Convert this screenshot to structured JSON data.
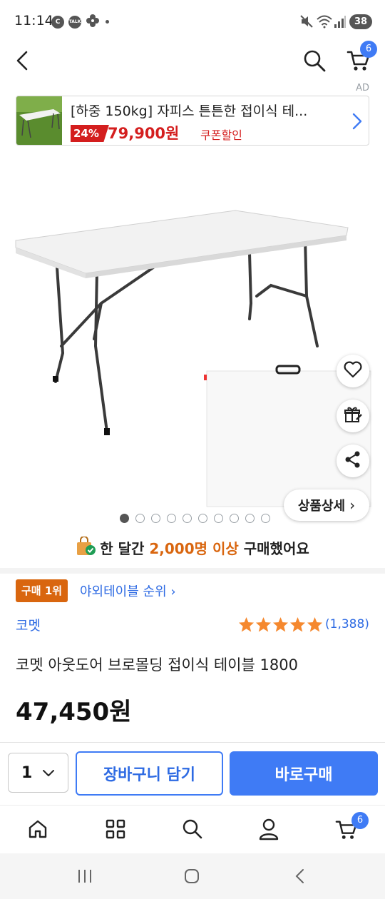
{
  "status_bar": {
    "time": "11:14",
    "notif_icons": [
      "c-icon",
      "talk-icon",
      "pinwheel-icon"
    ],
    "notif_c": "C",
    "notif_talk": "TALK",
    "battery": "38"
  },
  "top_nav": {
    "cart_count": "6"
  },
  "ad": {
    "label": "AD",
    "title": "[하중 150kg] 자피스 튼튼한 접이식 테...",
    "discount": "24%",
    "price": "79,900원",
    "coupon": "쿠폰할인"
  },
  "product": {
    "detail_button": "상품상세",
    "detail_arrow": "›",
    "image_count": 10,
    "active_image": 0,
    "purchase_note": {
      "prefix": "한 달간 ",
      "highlight": "2,000명 이상",
      "suffix": " 구매했어요"
    },
    "rank_badge": "구매 1위",
    "rank_link": "야외테이블 순위",
    "rank_arrow": "›",
    "brand": "코멧",
    "rating": 5,
    "review_count": "(1,388)",
    "name": "코멧 아웃도어 브로몰딩 접이식 테이블 1800",
    "price": "47,450원"
  },
  "buy_bar": {
    "quantity": "1",
    "cart_button": "장바구니 담기",
    "buy_button": "바로구매"
  },
  "tab_bar": {
    "cart_count": "6"
  },
  "colors": {
    "accent_blue": "#3f7bf5",
    "sale_red": "#d41e1e",
    "highlight_orange": "#d9660f",
    "link_blue": "#2d6ae3",
    "star": "#f5882e"
  }
}
